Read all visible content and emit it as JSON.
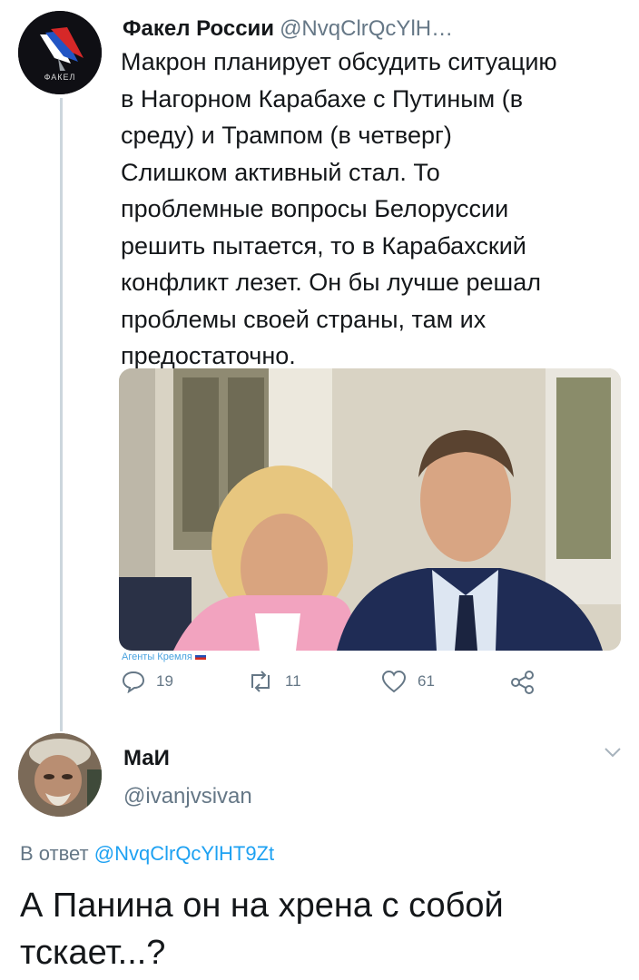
{
  "tweet": {
    "author_name": "Факел России",
    "author_handle": "@NvqClrQcYlH…",
    "avatar_caption": "ФАКЕЛ",
    "text": "Макрон планирует обсудить ситуацию\nв Нагорном Карабахе с Путиным (в\nсреду) и Трампом (в четверг)\nСлишком активный стал. То\nпроблемные вопросы Белоруссии\nрешить пытается, то в Карабахский\nконфликт лезет. Он бы лучше решал\nпроблемы своей страны, там их\nпредостаточно.",
    "image_watermark": "Агенты Кремля",
    "actions": {
      "reply_icon": "reply-icon",
      "reply_count": "19",
      "retweet_icon": "retweet-icon",
      "retweet_count": "11",
      "like_icon": "heart-icon",
      "like_count": "61",
      "share_icon": "share-icon"
    }
  },
  "reply": {
    "author_name": "МаИ",
    "author_handle": "@ivanjvsivan",
    "reply_to_prefix": "В ответ",
    "reply_to_mention": "@NvqClrQcYlHT9Zt",
    "text": "А Панина он на хрена с собой тскает...?"
  },
  "colors": {
    "link": "#1da1f2",
    "muted": "#657786",
    "thread_line": "#ccd6dd",
    "text": "#14171a"
  }
}
